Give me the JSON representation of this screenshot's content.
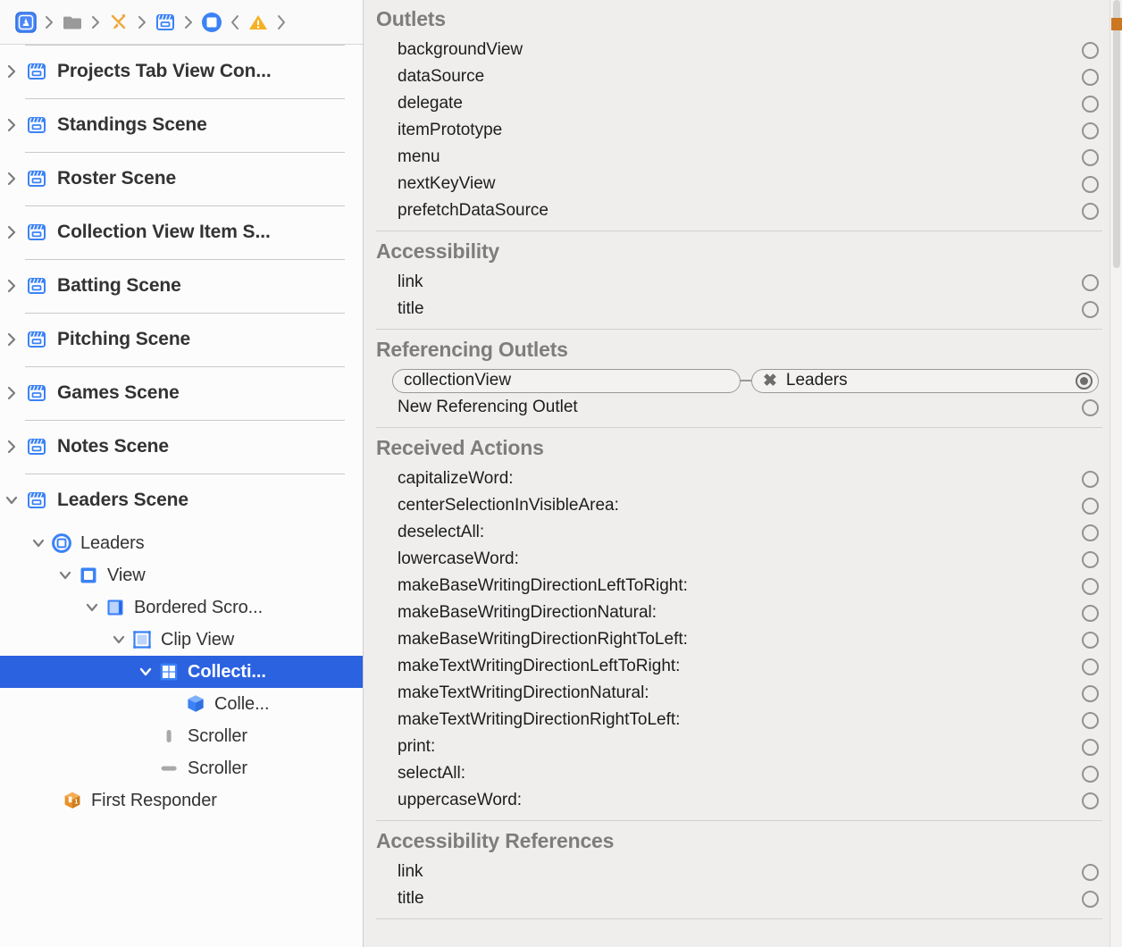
{
  "jump_bar": {
    "items": [
      {
        "icon": "xcode-app-icon",
        "name": "project-icon"
      },
      {
        "icon": "folder-icon",
        "name": "folder-icon"
      },
      {
        "icon": "interface-builder-icon",
        "name": "storyboard-file-icon"
      },
      {
        "icon": "scene-icon",
        "name": "scene-icon"
      },
      {
        "icon": "view-controller-icon",
        "name": "view-controller-icon"
      }
    ],
    "back_label": "<",
    "warning_label": "!",
    "forward_label": ">"
  },
  "sidebar": {
    "scenes": [
      {
        "label": "Projects Tab View Con...",
        "icon": "scene-icon",
        "expanded": false
      },
      {
        "label": "Standings Scene",
        "icon": "scene-icon",
        "expanded": false
      },
      {
        "label": "Roster Scene",
        "icon": "scene-icon",
        "expanded": false
      },
      {
        "label": "Collection View Item S...",
        "icon": "scene-icon",
        "expanded": false
      },
      {
        "label": "Batting Scene",
        "icon": "scene-icon",
        "expanded": false
      },
      {
        "label": "Pitching Scene",
        "icon": "scene-icon",
        "expanded": false
      },
      {
        "label": "Games Scene",
        "icon": "scene-icon",
        "expanded": false
      },
      {
        "label": "Notes Scene",
        "icon": "scene-icon",
        "expanded": false
      },
      {
        "label": "Leaders Scene",
        "icon": "scene-icon",
        "expanded": true
      }
    ],
    "children": [
      {
        "label": "Leaders",
        "icon": "view-controller-icon",
        "indent": 2,
        "twisty": "down",
        "selected": false
      },
      {
        "label": "View",
        "icon": "view-icon",
        "indent": 3,
        "twisty": "down",
        "selected": false
      },
      {
        "label": "Bordered Scro...",
        "icon": "scroll-view-icon",
        "indent": 4,
        "twisty": "down",
        "selected": false
      },
      {
        "label": "Clip View",
        "icon": "clip-view-icon",
        "indent": 5,
        "twisty": "down",
        "selected": false
      },
      {
        "label": "Collecti...",
        "icon": "collection-view-icon",
        "indent": 6,
        "twisty": "down",
        "selected": true
      },
      {
        "label": "Colle...",
        "icon": "collection-view-item-icon",
        "indent": 7,
        "twisty": "none",
        "selected": false
      },
      {
        "label": "Scroller",
        "icon": "scroller-vertical-icon",
        "indent": 6,
        "twisty": "none",
        "selected": false
      },
      {
        "label": "Scroller",
        "icon": "scroller-horizontal-icon",
        "indent": 6,
        "twisty": "none",
        "selected": false
      },
      {
        "label": "First Responder",
        "icon": "first-responder-icon",
        "indent": 2,
        "twisty": "none",
        "selected": false
      }
    ]
  },
  "inspector": {
    "sections": [
      {
        "title": "Outlets",
        "rows": [
          {
            "name": "backgroundView",
            "connected": false
          },
          {
            "name": "dataSource",
            "connected": false
          },
          {
            "name": "delegate",
            "connected": false
          },
          {
            "name": "itemPrototype",
            "connected": false
          },
          {
            "name": "menu",
            "connected": false
          },
          {
            "name": "nextKeyView",
            "connected": false
          },
          {
            "name": "prefetchDataSource",
            "connected": false
          }
        ]
      },
      {
        "title": "Accessibility",
        "rows": [
          {
            "name": "link",
            "connected": false
          },
          {
            "name": "title",
            "connected": false
          }
        ]
      },
      {
        "title": "Referencing Outlets",
        "pill": {
          "outlet_name": "collectionView",
          "target_name": "Leaders",
          "disconnect_glyph": "✖",
          "connected": true
        },
        "rows": [
          {
            "name": "New Referencing Outlet",
            "connected": false
          }
        ]
      },
      {
        "title": "Received Actions",
        "rows": [
          {
            "name": "capitalizeWord:",
            "connected": false
          },
          {
            "name": "centerSelectionInVisibleArea:",
            "connected": false
          },
          {
            "name": "deselectAll:",
            "connected": false
          },
          {
            "name": "lowercaseWord:",
            "connected": false
          },
          {
            "name": "makeBaseWritingDirectionLeftToRight:",
            "connected": false
          },
          {
            "name": "makeBaseWritingDirectionNatural:",
            "connected": false
          },
          {
            "name": "makeBaseWritingDirectionRightToLeft:",
            "connected": false
          },
          {
            "name": "makeTextWritingDirectionLeftToRight:",
            "connected": false
          },
          {
            "name": "makeTextWritingDirectionNatural:",
            "connected": false
          },
          {
            "name": "makeTextWritingDirectionRightToLeft:",
            "connected": false
          },
          {
            "name": "print:",
            "connected": false
          },
          {
            "name": "selectAll:",
            "connected": false
          },
          {
            "name": "uppercaseWord:",
            "connected": false
          }
        ]
      },
      {
        "title": "Accessibility References",
        "rows": [
          {
            "name": "link",
            "connected": false
          },
          {
            "name": "title",
            "connected": false
          }
        ]
      }
    ]
  },
  "colors": {
    "selection_blue": "#2b62e0",
    "accent_blue": "#3478f6",
    "scene_icon_blue": "#3b82f6",
    "warning_yellow": "#f5b125",
    "first_responder_orange": "#e8912a",
    "panel_bg": "#efeeed",
    "sidebar_bg": "#fcfcfc",
    "scroll_marker_orange": "#cc7722"
  }
}
